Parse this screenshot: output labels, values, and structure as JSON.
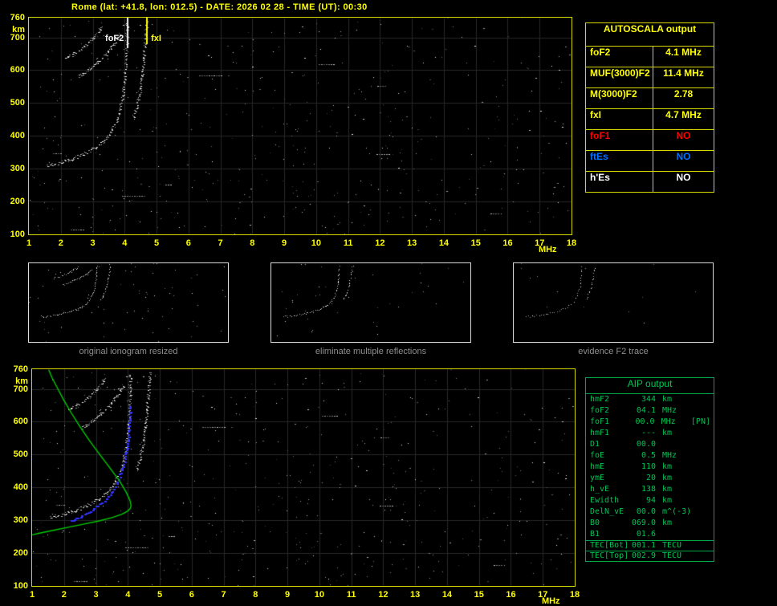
{
  "header": {
    "title": "Rome (lat: +41.8, lon: 012.5) - DATE: 2026 02 28 - TIME (UT): 00:30"
  },
  "autoscala": {
    "title": "AUTOSCALA output",
    "rows": [
      {
        "label": "foF2",
        "value": "4.1 MHz",
        "color": "#ffff00"
      },
      {
        "label": "MUF(3000)F2",
        "value": "11.4 MHz",
        "color": "#ffff00"
      },
      {
        "label": "M(3000)F2",
        "value": "2.78",
        "color": "#ffff00"
      },
      {
        "label": "fxI",
        "value": "4.7 MHz",
        "color": "#ffff00"
      },
      {
        "label": "foF1",
        "value": "NO",
        "color": "#ff0000"
      },
      {
        "label": "ftEs",
        "value": "NO",
        "color": "#0070ff"
      },
      {
        "label": "h'Es",
        "value": "NO",
        "color": "#ffffff"
      }
    ]
  },
  "thumbnails": [
    {
      "caption": "original ionogram resized"
    },
    {
      "caption": "eliminate multiple reflections"
    },
    {
      "caption": "evidence F2 trace"
    }
  ],
  "aip": {
    "title": "AIP output",
    "rows": [
      {
        "label": "hmF2",
        "value": "344",
        "unit": "km",
        "note": ""
      },
      {
        "label": "foF2",
        "value": "04.1",
        "unit": "MHz",
        "note": ""
      },
      {
        "label": "foF1",
        "value": "00.0",
        "unit": "MHz",
        "note": "[PN]"
      },
      {
        "label": "hmF1",
        "value": "---",
        "unit": "km",
        "note": ""
      },
      {
        "label": "D1",
        "value": "00.0",
        "unit": "",
        "note": ""
      },
      {
        "label": "foE",
        "value": "0.5",
        "unit": "MHz",
        "note": ""
      },
      {
        "label": "hmE",
        "value": "110",
        "unit": "km",
        "note": ""
      },
      {
        "label": "ymE",
        "value": "20",
        "unit": "km",
        "note": ""
      },
      {
        "label": "h_vE",
        "value": "138",
        "unit": "km",
        "note": ""
      },
      {
        "label": "Ewidth",
        "value": "94",
        "unit": "km",
        "note": ""
      },
      {
        "label": "DelN_vE",
        "value": "00.0",
        "unit": "m^(-3)",
        "note": ""
      },
      {
        "label": "B0",
        "value": "069.0",
        "unit": "km",
        "note": ""
      },
      {
        "label": "B1",
        "value": "01.6",
        "unit": "",
        "note": ""
      }
    ],
    "tec_rows": [
      {
        "label": "TEC[Bot]",
        "value": "001.1",
        "unit": "TECU"
      },
      {
        "label": "TEC[Top]",
        "value": "002.9",
        "unit": "TECU"
      }
    ]
  },
  "chart_data": [
    {
      "type": "scatter",
      "title": "Recorded ionogram with AUTOSCALA scaled characteristics",
      "xlabel": "MHz",
      "ylabel": "km",
      "xlim": [
        1,
        18
      ],
      "ylim": [
        100,
        760
      ],
      "x_ticks": [
        1,
        2,
        3,
        4,
        5,
        6,
        7,
        8,
        9,
        10,
        11,
        12,
        13,
        14,
        15,
        16,
        17,
        18
      ],
      "y_ticks": [
        760,
        700,
        600,
        500,
        400,
        300,
        200,
        100
      ],
      "grid": true,
      "legend_position": "none",
      "markers": [
        {
          "name": "foF2-marker",
          "label": "foF2",
          "x": 4.1,
          "color": "#f2f2f2",
          "label_side": "left"
        },
        {
          "name": "fxI-marker",
          "label": "fxI",
          "x": 4.7,
          "color": "#ffff00",
          "label_side": "right"
        }
      ],
      "series": [
        {
          "name": "F2 ordinary trace (virtual height)",
          "style": "dots",
          "color": "#ffffff",
          "x": [
            1.55,
            1.75,
            1.95,
            2.15,
            2.35,
            2.55,
            2.75,
            2.95,
            3.15,
            3.35,
            3.5,
            3.62,
            3.72,
            3.8,
            3.87,
            3.92,
            3.97,
            4.0,
            4.03,
            4.05,
            4.07,
            4.08
          ],
          "y": [
            310,
            313,
            317,
            322,
            328,
            336,
            345,
            356,
            369,
            386,
            403,
            421,
            440,
            461,
            484,
            509,
            538,
            565,
            600,
            640,
            690,
            745
          ]
        },
        {
          "name": "F2 extraordinary trace (virtual height)",
          "style": "dots",
          "color": "#ffffff",
          "x": [
            4.28,
            4.36,
            4.43,
            4.49,
            4.54,
            4.58,
            4.62,
            4.65,
            4.67,
            4.69
          ],
          "y": [
            455,
            480,
            510,
            543,
            578,
            615,
            655,
            695,
            725,
            755
          ]
        },
        {
          "name": "second-hop multiple reflection 1",
          "style": "dots",
          "color": "#ffffff",
          "x": [
            2.15,
            2.35,
            2.55,
            2.75,
            2.95,
            3.15,
            3.3
          ],
          "y": [
            635,
            645,
            657,
            672,
            690,
            712,
            735
          ]
        },
        {
          "name": "second-hop multiple reflection 2",
          "style": "dots",
          "color": "#ffffff",
          "x": [
            2.55,
            2.75,
            2.95,
            3.15,
            3.35,
            3.55,
            3.75,
            3.9
          ],
          "y": [
            580,
            592,
            606,
            622,
            641,
            663,
            690,
            715
          ]
        }
      ]
    },
    {
      "type": "scatter",
      "title": "Recorded ionogram with AIP inverted electron density profile",
      "xlabel": "MHz",
      "ylabel": "km",
      "xlim": [
        1,
        18
      ],
      "ylim": [
        100,
        760
      ],
      "x_ticks": [
        1,
        2,
        3,
        4,
        5,
        6,
        7,
        8,
        9,
        10,
        11,
        12,
        13,
        14,
        15,
        16,
        17,
        18
      ],
      "y_ticks": [
        760,
        700,
        600,
        500,
        400,
        300,
        200,
        100
      ],
      "grid": true,
      "legend_position": "none",
      "series": [
        {
          "name": "F2 ordinary trace (virtual height)",
          "style": "dots",
          "color": "#ffffff",
          "x": [
            1.55,
            1.75,
            1.95,
            2.15,
            2.35,
            2.55,
            2.75,
            2.95,
            3.15,
            3.35,
            3.5,
            3.62,
            3.72,
            3.8,
            3.87,
            3.92,
            3.97,
            4.0,
            4.03,
            4.05,
            4.07,
            4.08
          ],
          "y": [
            310,
            313,
            317,
            322,
            328,
            336,
            345,
            356,
            369,
            386,
            403,
            421,
            440,
            461,
            484,
            509,
            538,
            565,
            600,
            640,
            690,
            745
          ]
        },
        {
          "name": "F2 extraordinary trace (virtual height)",
          "style": "dots",
          "color": "#ffffff",
          "x": [
            4.28,
            4.36,
            4.43,
            4.49,
            4.54,
            4.58,
            4.62,
            4.65,
            4.67,
            4.69
          ],
          "y": [
            455,
            480,
            510,
            543,
            578,
            615,
            655,
            695,
            725,
            755
          ]
        },
        {
          "name": "second-hop multiple reflection 1",
          "style": "dots",
          "color": "#ffffff",
          "x": [
            2.15,
            2.35,
            2.55,
            2.75,
            2.95,
            3.15,
            3.3
          ],
          "y": [
            635,
            645,
            657,
            672,
            690,
            712,
            735
          ]
        },
        {
          "name": "second-hop multiple reflection 2",
          "style": "dots",
          "color": "#ffffff",
          "x": [
            2.55,
            2.75,
            2.95,
            3.15,
            3.35,
            3.55,
            3.75,
            3.9
          ],
          "y": [
            580,
            592,
            606,
            622,
            641,
            663,
            690,
            715
          ]
        },
        {
          "name": "reconstructed F2 trace from profile",
          "style": "dots-thick",
          "color": "#3333ff",
          "x": [
            2.2,
            2.45,
            2.7,
            2.95,
            3.2,
            3.42,
            3.6,
            3.74,
            3.85,
            3.93,
            3.99,
            4.03,
            4.06,
            4.08
          ],
          "y": [
            299,
            308,
            320,
            335,
            354,
            377,
            403,
            432,
            464,
            500,
            540,
            583,
            625,
            655
          ]
        },
        {
          "name": "electron density profile (plasma frequency vs real height)",
          "style": "line",
          "color": "#00cc00",
          "x": [
            1.52,
            1.62,
            1.78,
            1.98,
            2.22,
            2.5,
            2.8,
            3.12,
            3.45,
            3.75,
            3.95,
            4.07,
            4.1,
            4.07,
            3.98,
            3.8,
            3.5,
            3.1,
            2.6,
            2.1,
            1.6,
            1.2,
            0.98
          ],
          "y": [
            758,
            735,
            705,
            668,
            628,
            585,
            542,
            500,
            458,
            418,
            385,
            360,
            344,
            335,
            327,
            318,
            308,
            298,
            288,
            278,
            268,
            260,
            255
          ]
        }
      ]
    }
  ]
}
